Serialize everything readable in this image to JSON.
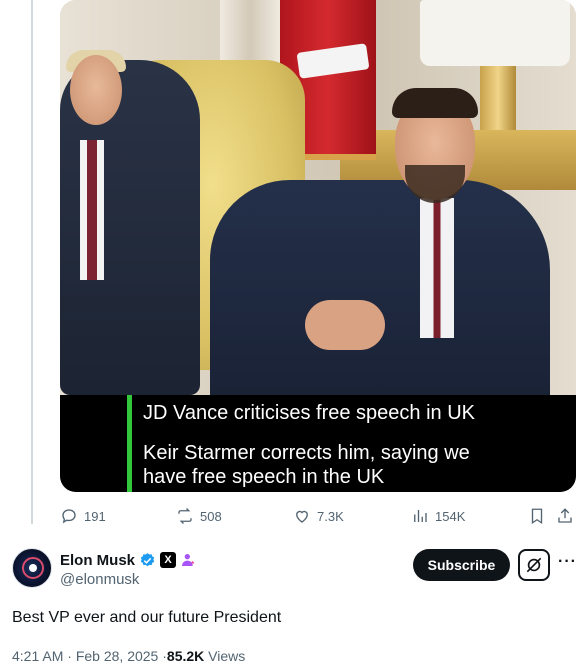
{
  "media": {
    "caption_headline": "JD Vance criticises free speech in UK",
    "caption_line_1": "Keir Starmer corrects him, saying we",
    "caption_line_2": "have free speech in the UK",
    "caption_accent_color": "#33c83b"
  },
  "engagement": {
    "replies": "191",
    "reposts": "508",
    "likes": "7.3K",
    "views": "154K",
    "icons": [
      "reply-icon",
      "repost-icon",
      "like-icon",
      "views-icon",
      "bookmark-icon",
      "share-icon"
    ]
  },
  "author": {
    "display_name": "Elon Musk",
    "handle": "@elonmusk",
    "verified_badge_color": "#1d9bf0",
    "affiliate_badge": "X",
    "subscribe_label": "Subscribe"
  },
  "post": {
    "text": "Best VP ever and our future President",
    "time": "4:21 AM",
    "separator": "·",
    "date": "Feb 28, 2025",
    "views_count": "85.2K",
    "views_label": "Views"
  }
}
